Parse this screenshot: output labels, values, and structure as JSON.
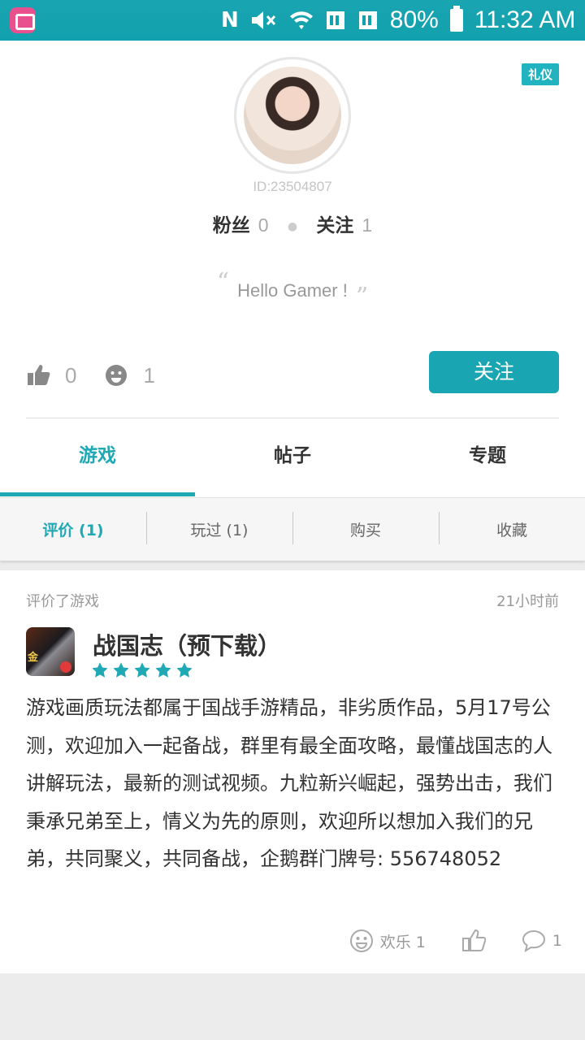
{
  "status_bar": {
    "battery": "80%",
    "time": "11:32 AM",
    "icons": [
      "app-icon",
      "nfc-icon",
      "mute-icon",
      "wifi-icon",
      "sim1-icon",
      "sim2-icon",
      "battery-icon"
    ]
  },
  "profile": {
    "badge": "礼仪",
    "user_id": "ID:23504807",
    "fans_label": "粉丝",
    "fans_count": "0",
    "following_label": "关注",
    "following_count": "1",
    "motto": "Hello Gamer !",
    "likes": "0",
    "fun": "1",
    "follow_button": "关注"
  },
  "tabs": [
    {
      "label": "游戏",
      "active": true
    },
    {
      "label": "帖子",
      "active": false
    },
    {
      "label": "专题",
      "active": false
    }
  ],
  "subtabs": [
    {
      "label": "评价 (1)",
      "active": true
    },
    {
      "label": "玩过 (1)",
      "active": false
    },
    {
      "label": "购买",
      "active": false
    },
    {
      "label": "收藏",
      "active": false
    }
  ],
  "review": {
    "action": "评价了游戏",
    "time": "21小时前",
    "game_title": "战国志（预下载）",
    "icon_text": "金",
    "rating": 5,
    "body": "游戏画质玩法都属于国战手游精品，非劣质作品，5月17号公测，欢迎加入一起备战，群里有最全面攻略，最懂战国志的人讲解玩法，最新的测试视频。九粒新兴崛起，强势出击，我们秉承兄弟至上，情义为先的原则，欢迎所以想加入我们的兄弟，共同聚义，共同备战，企鹅群门牌号: 556748052",
    "fun_label": "欢乐 1",
    "comment_count": "1"
  },
  "colors": {
    "accent": "#1ea9b5",
    "status_bar": "#12a1ae"
  }
}
